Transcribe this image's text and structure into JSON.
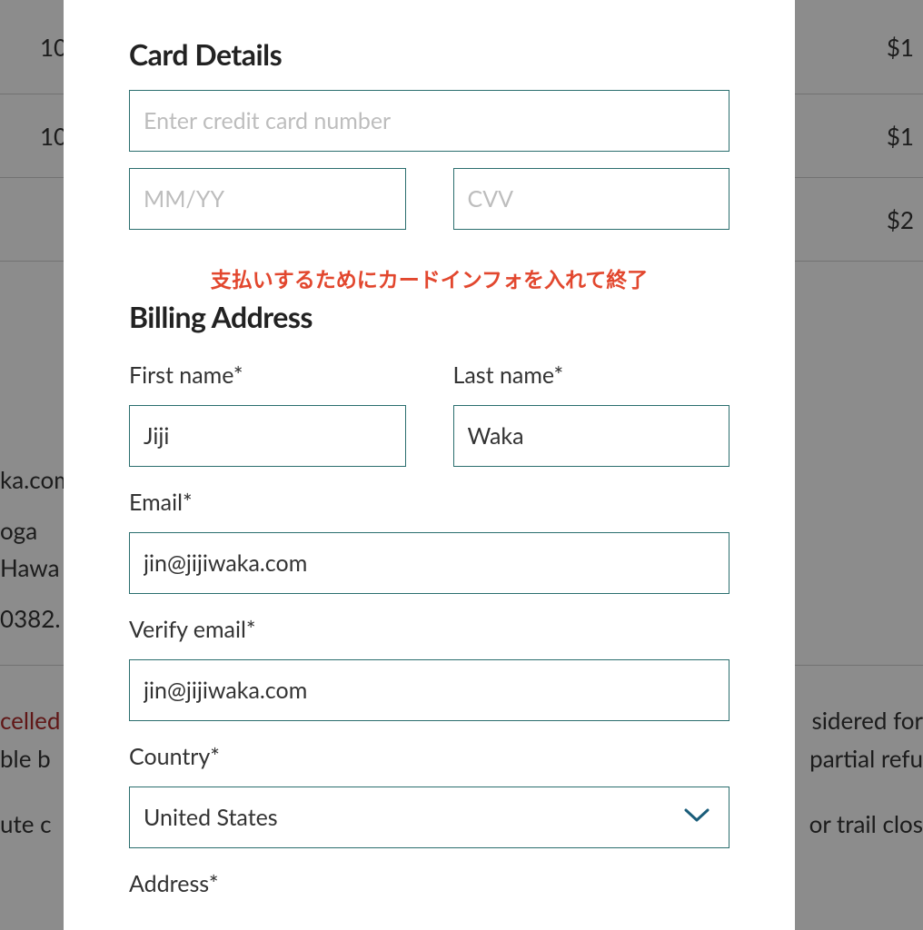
{
  "background": {
    "rows": [
      {
        "left": "10,",
        "right": "$1"
      },
      {
        "left": "10,",
        "right": "$1"
      },
      {
        "left": "",
        "right": "$2"
      }
    ],
    "contact": {
      "line1": "ka.com",
      "line2": "oga",
      "line3": "Hawa",
      "line4": "0382."
    },
    "policy": {
      "frag1a": "celled",
      "frag1b": "sidered for",
      "frag2a": "ble b",
      "frag2b": "partial refu",
      "frag3a": "ute c",
      "frag3b": "or trail clos"
    }
  },
  "modal": {
    "card": {
      "heading": "Card Details",
      "number_placeholder": "Enter credit card number",
      "exp_placeholder": "MM/YY",
      "cvv_placeholder": "CVV",
      "warning": "支払いするためにカードインフォを入れて終了"
    },
    "billing": {
      "heading": "Billing Address",
      "first_label": "First name*",
      "first_value": "Jiji",
      "last_label": "Last name*",
      "last_value": "Waka",
      "email_label": "Email*",
      "email_value": "jin@jijiwaka.com",
      "verify_label": "Verify email*",
      "verify_value": "jin@jijiwaka.com",
      "country_label": "Country*",
      "country_value": "United States",
      "address_label": "Address*"
    }
  }
}
